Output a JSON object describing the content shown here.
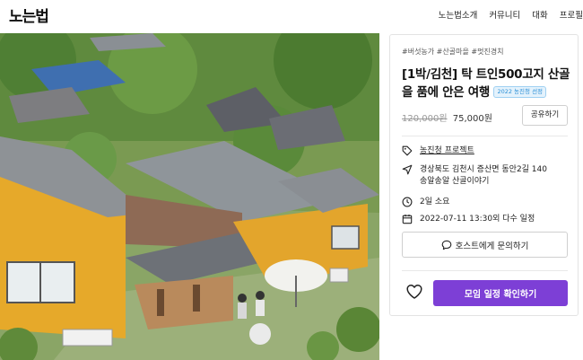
{
  "header": {
    "logo": "노는법",
    "nav": [
      "노는법소개",
      "커뮤니티",
      "대화",
      "프로필"
    ]
  },
  "hero": {
    "alt_description_icon": "photo"
  },
  "product": {
    "tags": "#버섯농가 #산골마을 #멋진경치",
    "title": "[1박/김천] 탁 트인500고지 산골을 품에 안은 여행",
    "badge": "2022 농진청 선정",
    "price_old": "120,000원",
    "price_new": "75,000원",
    "share_label": "공유하기",
    "project_link": "농진청 프로젝트",
    "address_line1": "경상북도 김천시 증산면 동안2길 140",
    "address_line2": "송알송알 산골이야기",
    "duration": "2일 소요",
    "schedule": "2022-07-11 13:30외 다수 일정",
    "ask_label": "호스트에게 문의하기",
    "book_label": "모임 일정 확인하기"
  },
  "colors": {
    "accent": "#7d3fd6",
    "badge": "#2a8fd6"
  }
}
